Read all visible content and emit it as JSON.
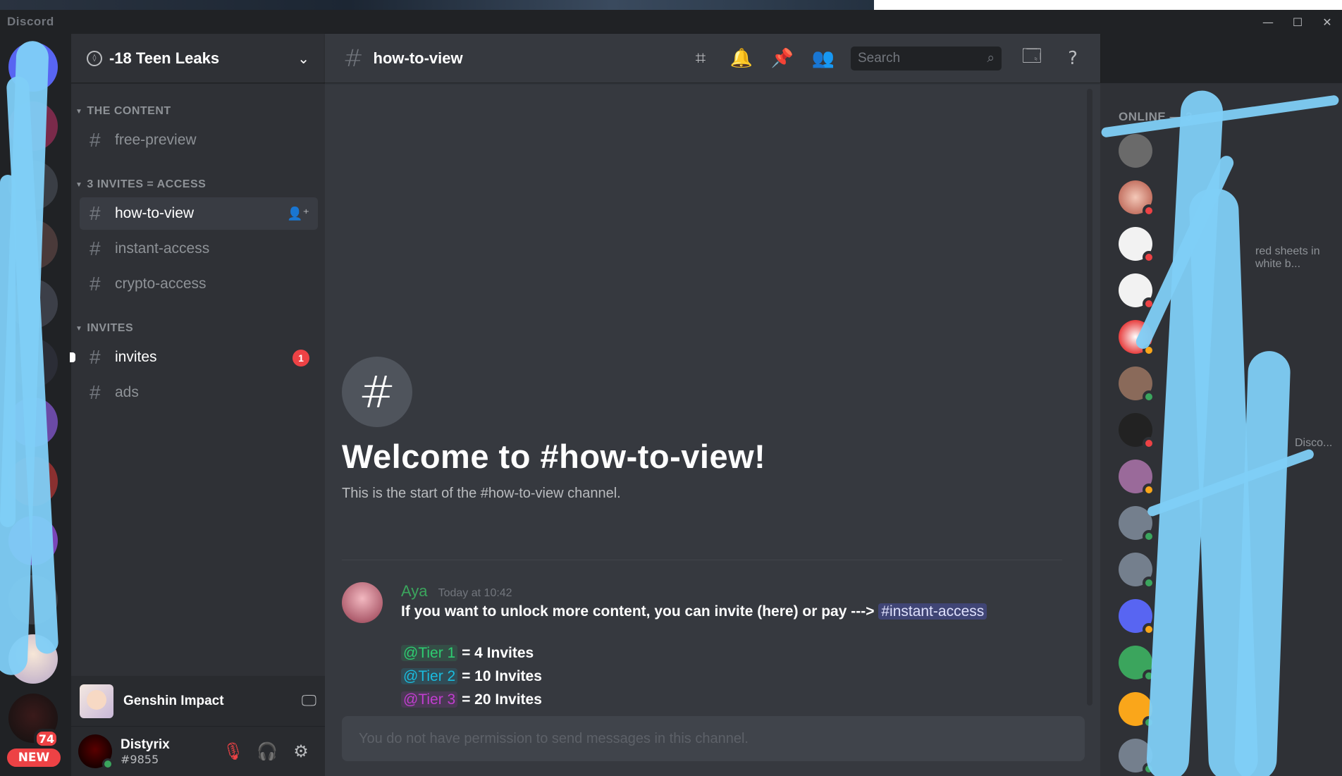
{
  "app": {
    "brand": "Discord"
  },
  "window_controls": {
    "minimize": "—",
    "maximize": "☐",
    "close": "✕"
  },
  "servers": {
    "badges": [
      "74"
    ],
    "new_label": "NEW"
  },
  "guild": {
    "name": "-18 Teen Leaks"
  },
  "categories": [
    {
      "label": "THE CONTENT",
      "channels": [
        {
          "name": "free-preview"
        }
      ]
    },
    {
      "label": "3 INVITES = ACCESS",
      "channels": [
        {
          "name": "how-to-view",
          "selected": true
        },
        {
          "name": "instant-access"
        },
        {
          "name": "crypto-access"
        }
      ]
    },
    {
      "label": "INVITES",
      "channels": [
        {
          "name": "invites",
          "unread": true,
          "mentions": "1"
        },
        {
          "name": "ads"
        }
      ]
    }
  ],
  "activity": {
    "title": "Genshin Impact"
  },
  "user": {
    "name": "Distyrix",
    "tag": "#9855"
  },
  "channel": {
    "name": "how-to-view"
  },
  "toolbar": {
    "search_placeholder": "Search"
  },
  "welcome": {
    "heading": "Welcome to #how-to-view!",
    "subtext": "This is the start of the #how-to-view channel."
  },
  "message": {
    "author": "Aya",
    "timestamp": "Today at 10:42",
    "text": "If you want to unlock more content, you can invite (here) or pay --->",
    "channel_mention": "#instant-access",
    "tiers": [
      {
        "role": "@Tier 1",
        "rest": "= 4 Invites",
        "color": "#2ecc71",
        "bg": "rgba(46,204,113,.15)"
      },
      {
        "role": "@Tier 2",
        "rest": "= 10 Invites",
        "color": "#1abcde",
        "bg": "rgba(26,188,222,.15)"
      },
      {
        "role": "@Tier 3",
        "rest": "= 20 Invites",
        "color": "#c13ecf",
        "bg": "rgba(193,62,207,.15)"
      }
    ]
  },
  "composer": {
    "placeholder": "You do not have permission to send messages in this channel."
  },
  "members": {
    "header": "ONLINE — 3",
    "snippets": [
      "red sheets in white b...",
      "Disco..."
    ]
  },
  "colors": {
    "accent": "#5865f2",
    "online": "#3ba55d",
    "dnd": "#ed4245",
    "idle": "#faa61a",
    "scribble": "#7fcff7"
  }
}
